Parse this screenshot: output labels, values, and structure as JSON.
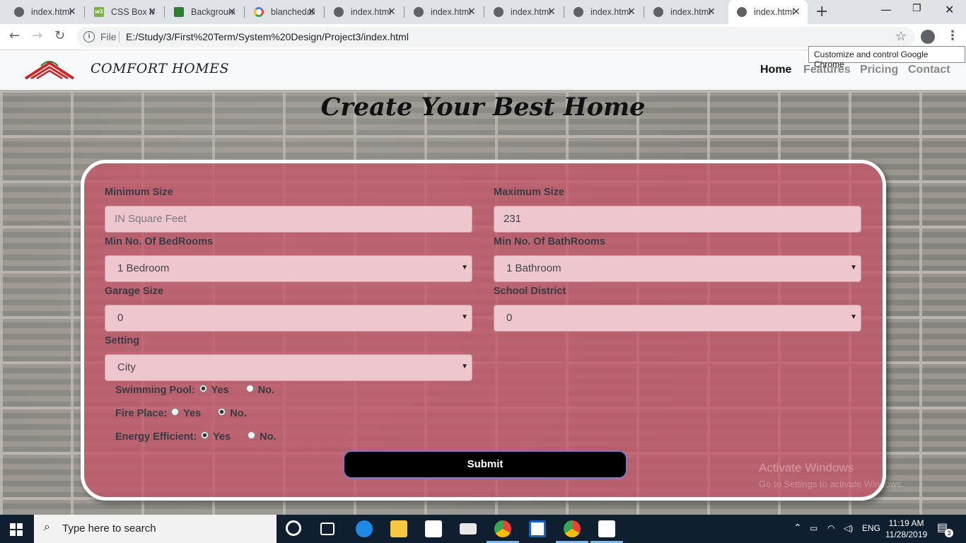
{
  "browser": {
    "tabs": [
      {
        "title": "index.html",
        "icon": "globe-icon"
      },
      {
        "title": "CSS Box Model",
        "icon": "w3-icon"
      },
      {
        "title": "Background",
        "icon": "bg-icon"
      },
      {
        "title": "blanchedalmond",
        "icon": "google-icon"
      },
      {
        "title": "index.html",
        "icon": "globe-icon"
      },
      {
        "title": "index.html",
        "icon": "globe-icon"
      },
      {
        "title": "index.html",
        "icon": "globe-icon"
      },
      {
        "title": "index.html",
        "icon": "globe-icon"
      },
      {
        "title": "index.html",
        "icon": "globe-icon"
      },
      {
        "title": "index.html",
        "icon": "globe-icon"
      }
    ],
    "omnibox": {
      "scheme_label": "File",
      "url": "E:/Study/3/First%20Term/System%20Design/Project3/index.html"
    },
    "tooltip": "Customize and control Google Chrome"
  },
  "site": {
    "brand": "COMFORT HOMES",
    "nav": [
      "Home",
      "Features",
      "Pricing",
      "Contact"
    ],
    "heading": "Create Your Best Home"
  },
  "form": {
    "min_size": {
      "label": "Minimum Size",
      "placeholder": "IN Square Feet",
      "value": ""
    },
    "max_size": {
      "label": "Maximum Size",
      "value": "231"
    },
    "bedrooms": {
      "label": "Min No. Of BedRooms",
      "value": "1 Bedroom"
    },
    "bathrooms": {
      "label": "Min No. Of BathRooms",
      "value": "1 Bathroom"
    },
    "garage": {
      "label": "Garage Size",
      "value": "0"
    },
    "school": {
      "label": "School District",
      "value": "0"
    },
    "setting": {
      "label": "Setting",
      "value": "City"
    },
    "pool": {
      "label": "Swimming Pool:",
      "yes": "Yes",
      "no": "No.",
      "selected": "yes"
    },
    "fireplace": {
      "label": "Fire Place:",
      "yes": "Yes",
      "no": "No.",
      "selected": "no"
    },
    "energy": {
      "label": "Energy Efficient:",
      "yes": "Yes",
      "no": "No.",
      "selected": "yes"
    },
    "submit_label": "Submit"
  },
  "watermark": {
    "title": "Activate Windows",
    "subtitle": "Go to Settings to activate Windows."
  },
  "taskbar": {
    "search_placeholder": "Type here to search",
    "language": "ENG",
    "time": "11:19 AM",
    "date": "11/28/2019",
    "notifications": "3"
  },
  "colors": {
    "form_bg": "#c45468",
    "submit_bg": "#000000",
    "nav_active": "#111111"
  }
}
